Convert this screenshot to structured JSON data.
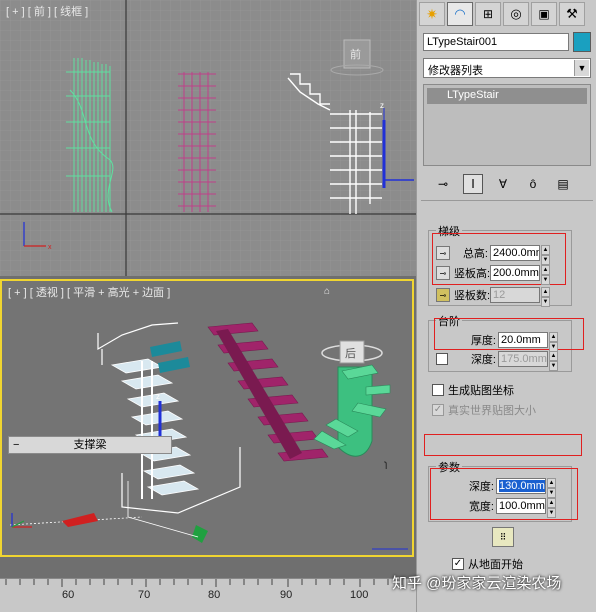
{
  "viewports": {
    "top_label": "[ + ] [ 前 ] [ 线框 ]",
    "persp_label": "[ + ] [ 透视 ] [ 平滑 + 高光 + 边面 ]",
    "viewcube_label": "前",
    "persp_cube_label": "后"
  },
  "panel": {
    "tabs": [
      "create-icon",
      "modify-icon",
      "hierarchy-icon",
      "motion-icon",
      "display-icon",
      "utilities-icon"
    ],
    "object_name": "LTypeStair001",
    "object_color": "#1aa0c0",
    "modifier_list": "修改器列表",
    "stack_item": "LTypeStair",
    "stairs_group": {
      "title": "梯级",
      "total_height_label": "总高:",
      "total_height_value": "2400.0mm",
      "riser_height_label": "竖板高:",
      "riser_height_value": "200.0mm",
      "riser_count_label": "竖板数:",
      "riser_count_value": "12"
    },
    "steps_group": {
      "title": "台阶",
      "thickness_label": "厚度:",
      "thickness_value": "20.0mm",
      "depth_label": "深度:",
      "depth_value": "175.0mm"
    },
    "gen_mapping": "生成贴图坐标",
    "real_world": "真实世界贴图大小",
    "stringer_rollout": "支撑梁",
    "params_group": {
      "title": "参数",
      "depth_label": "深度:",
      "depth_value": "130.0mm",
      "width_label": "宽度:",
      "width_value": "100.0mm"
    },
    "from_floor": "从地面开始"
  },
  "ruler": {
    "ticks": [
      "60",
      "70",
      "80",
      "90",
      "100"
    ]
  },
  "watermark": "知乎 @玢家家云渲染农场"
}
